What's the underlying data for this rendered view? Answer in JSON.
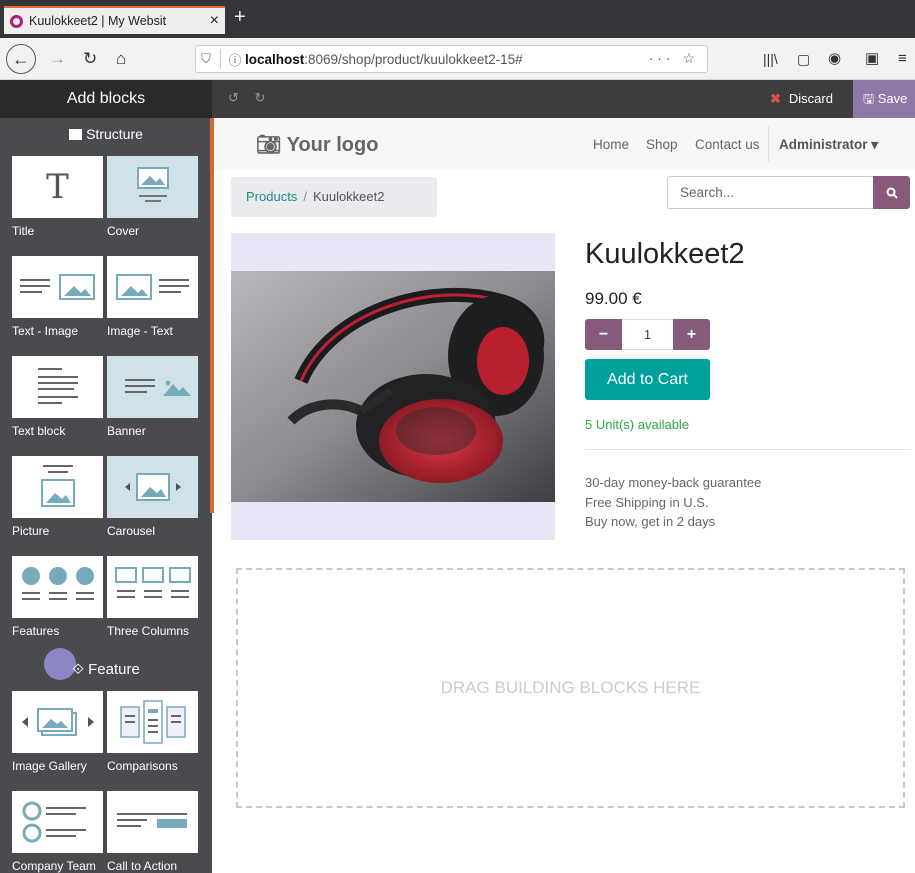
{
  "browser": {
    "tab_title": "Kuulokkeet2 | My Websit",
    "new_tab": "+",
    "url_host": "localhost",
    "url_rest": ":8069/shop/product/kuulokkeet2-15#",
    "url_more": "··· ☆"
  },
  "editor": {
    "add_blocks": "Add blocks",
    "undo_redo": "↺ ↻",
    "discard": "Discard",
    "save": "Save"
  },
  "sidebar": {
    "structure_title": "Structure",
    "feature_title": "Feature",
    "blocks": [
      "Title",
      "Cover",
      "Text - Image",
      "Image - Text",
      "Text block",
      "Banner",
      "Picture",
      "Carousel",
      "Features",
      "Three Columns",
      "Image Gallery",
      "Comparisons",
      "Company Team",
      "Call to Action"
    ]
  },
  "site": {
    "logo": "Your logo",
    "menu": [
      "Home",
      "Shop",
      "Contact us"
    ],
    "admin": "Administrator ▾"
  },
  "breadcrumb": {
    "link": "Products",
    "separator": "/",
    "current": "Kuulokkeet2"
  },
  "search": {
    "placeholder": "Search..."
  },
  "product": {
    "name": "Kuulokkeet2",
    "price": "99.00 €",
    "qty_minus": "−",
    "qty_value": "1",
    "qty_plus": "+",
    "add_to_cart": "Add to Cart",
    "availability": "5 Unit(s) available",
    "guarantees": [
      "30-day money-back guarantee",
      "Free Shipping in U.S.",
      "Buy now, get in 2 days"
    ]
  },
  "dropzone": {
    "text": "DRAG BUILDING BLOCKS HERE"
  },
  "colors": {
    "odoo_purple": "#875a7b",
    "teal": "#00a09d",
    "sidebar_bg": "#4a4b4e"
  }
}
